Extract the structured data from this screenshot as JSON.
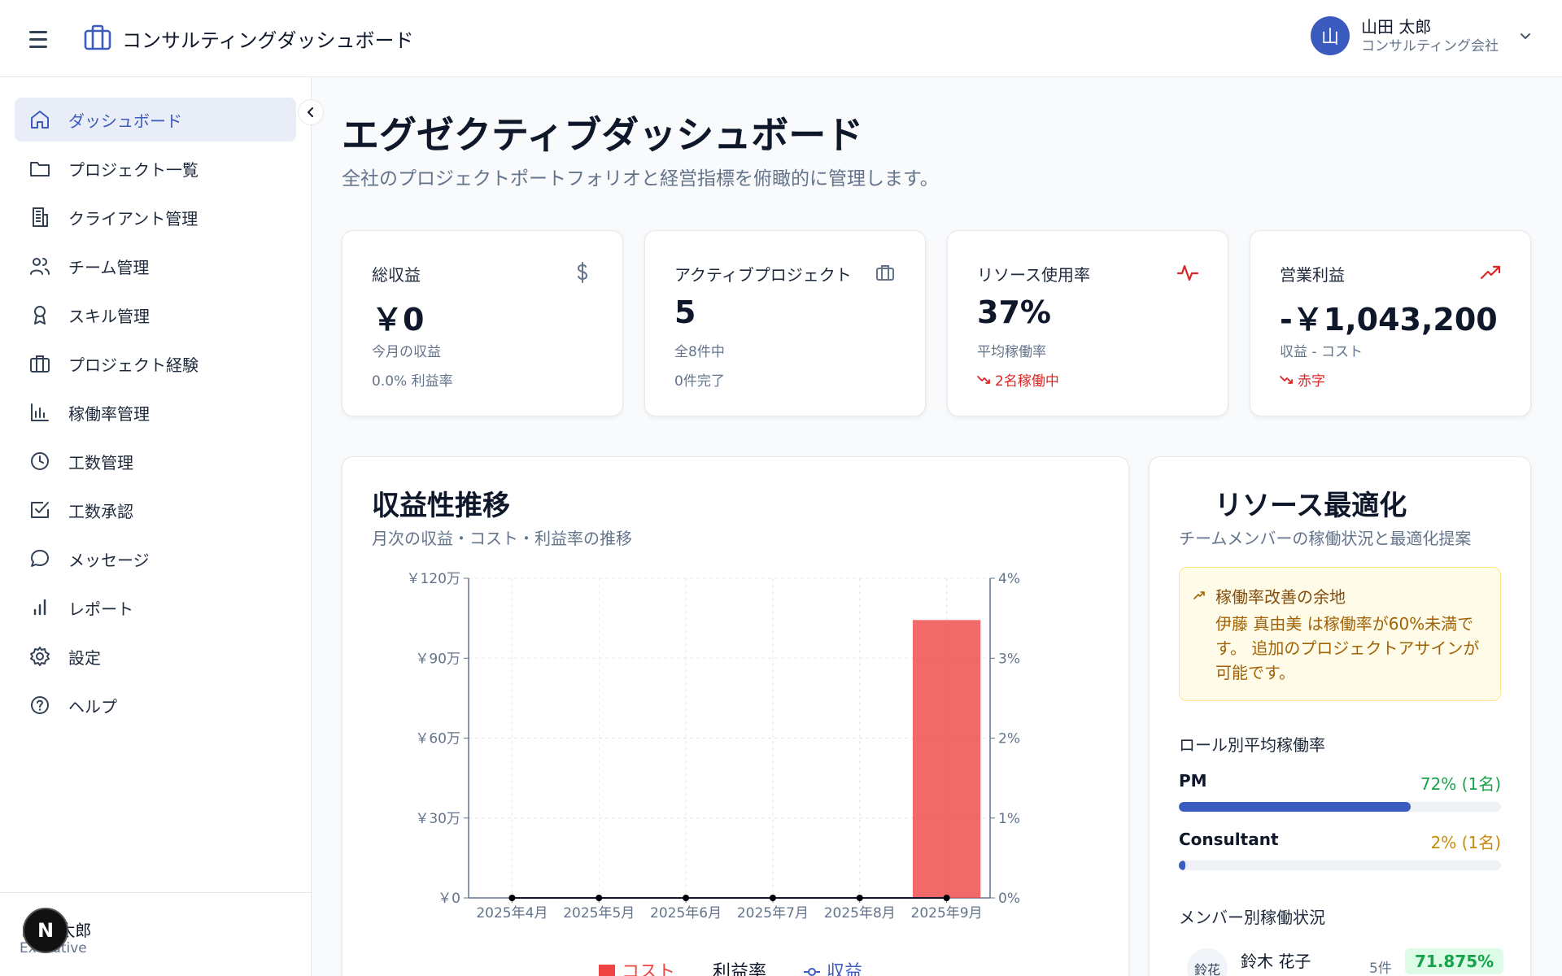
{
  "header": {
    "app_title": "コンサルティングダッシュボード",
    "user_initial": "山",
    "user_name": "山田 太郎",
    "user_company": "コンサルティング会社"
  },
  "sidebar": {
    "items": [
      {
        "label": "ダッシュボード",
        "icon": "home-icon",
        "active": true
      },
      {
        "label": "プロジェクト一覧",
        "icon": "folder-icon"
      },
      {
        "label": "クライアント管理",
        "icon": "building-icon"
      },
      {
        "label": "チーム管理",
        "icon": "users-icon"
      },
      {
        "label": "スキル管理",
        "icon": "award-icon"
      },
      {
        "label": "プロジェクト経験",
        "icon": "briefcase-icon"
      },
      {
        "label": "稼働率管理",
        "icon": "bar-chart-icon"
      },
      {
        "label": "工数管理",
        "icon": "clock-icon"
      },
      {
        "label": "工数承認",
        "icon": "check-square-icon"
      },
      {
        "label": "メッセージ",
        "icon": "message-icon"
      },
      {
        "label": "レポート",
        "icon": "signal-icon"
      },
      {
        "label": "設定",
        "icon": "gear-icon"
      },
      {
        "label": "ヘルプ",
        "icon": "help-icon"
      }
    ],
    "footer_name": "山田 太郎",
    "footer_role": "Executive",
    "badge_letter": "N"
  },
  "main": {
    "title": "エグゼクティブダッシュボード",
    "subtitle": "全社のプロジェクトポートフォリオと経営指標を俯瞰的に管理します。"
  },
  "stats": [
    {
      "label": "総収益",
      "icon": "dollar-icon",
      "value": "￥0",
      "note": "今月の収益",
      "extra": "0.0% 利益率"
    },
    {
      "label": "アクティブプロジェクト",
      "icon": "briefcase-icon",
      "value": "5",
      "note": "全8件中",
      "extra": "0件完了"
    },
    {
      "label": "リソース使用率",
      "icon": "activity-icon",
      "value": "37%",
      "note": "平均稼働率",
      "extra": "2名稼働中"
    },
    {
      "label": "営業利益",
      "icon": "trending-up-icon",
      "value": "-￥1,043,200",
      "note": "収益 - コスト",
      "extra": "赤字"
    }
  ],
  "profit_panel": {
    "title": "収益性推移",
    "subtitle": "月次の収益・コスト・利益率の推移"
  },
  "chart_data": {
    "type": "bar",
    "categories": [
      "2025年4月",
      "2025年5月",
      "2025年6月",
      "2025年7月",
      "2025年8月",
      "2025年9月"
    ],
    "y_left_ticks": [
      "￥0",
      "￥30万",
      "￥60万",
      "￥90万",
      "￥120万"
    ],
    "y_right_ticks": [
      "0%",
      "1%",
      "2%",
      "3%",
      "4%"
    ],
    "ylim_left": [
      0,
      1200000
    ],
    "ylim_right": [
      0,
      4
    ],
    "series": [
      {
        "name": "コスト",
        "type": "bar",
        "color": "#ef4444",
        "values": [
          0,
          0,
          0,
          0,
          0,
          1043200
        ]
      },
      {
        "name": "利益率",
        "type": "line",
        "color": "#000000",
        "values": [
          0,
          0,
          0,
          0,
          0,
          0
        ]
      },
      {
        "name": "収益",
        "type": "line",
        "color": "#3b5bbf",
        "values": [
          0,
          0,
          0,
          0,
          0,
          0
        ]
      }
    ],
    "grid": true,
    "legend": "bottom"
  },
  "resource_panel": {
    "title": "リソース最適化",
    "subtitle": "チームメンバーの稼働状況と最適化提案",
    "alert_title": "稼働率改善の余地",
    "alert_body": "伊藤 真由美 は稼働率が60%未満です。 追加のプロジェクトアサインが可能です。",
    "role_heading": "ロール別平均稼働率",
    "roles": [
      {
        "name": "PM",
        "value_text": "72% (1名)",
        "percent": 72,
        "color": "#16a34a"
      },
      {
        "name": "Consultant",
        "value_text": "2% (1名)",
        "percent": 2,
        "color": "#ca8a04"
      }
    ],
    "member_heading": "メンバー別稼働状況",
    "members": [
      {
        "initials": "鈴花",
        "name": "鈴木 花子",
        "count": "5件",
        "rate": "71.875%"
      }
    ]
  }
}
